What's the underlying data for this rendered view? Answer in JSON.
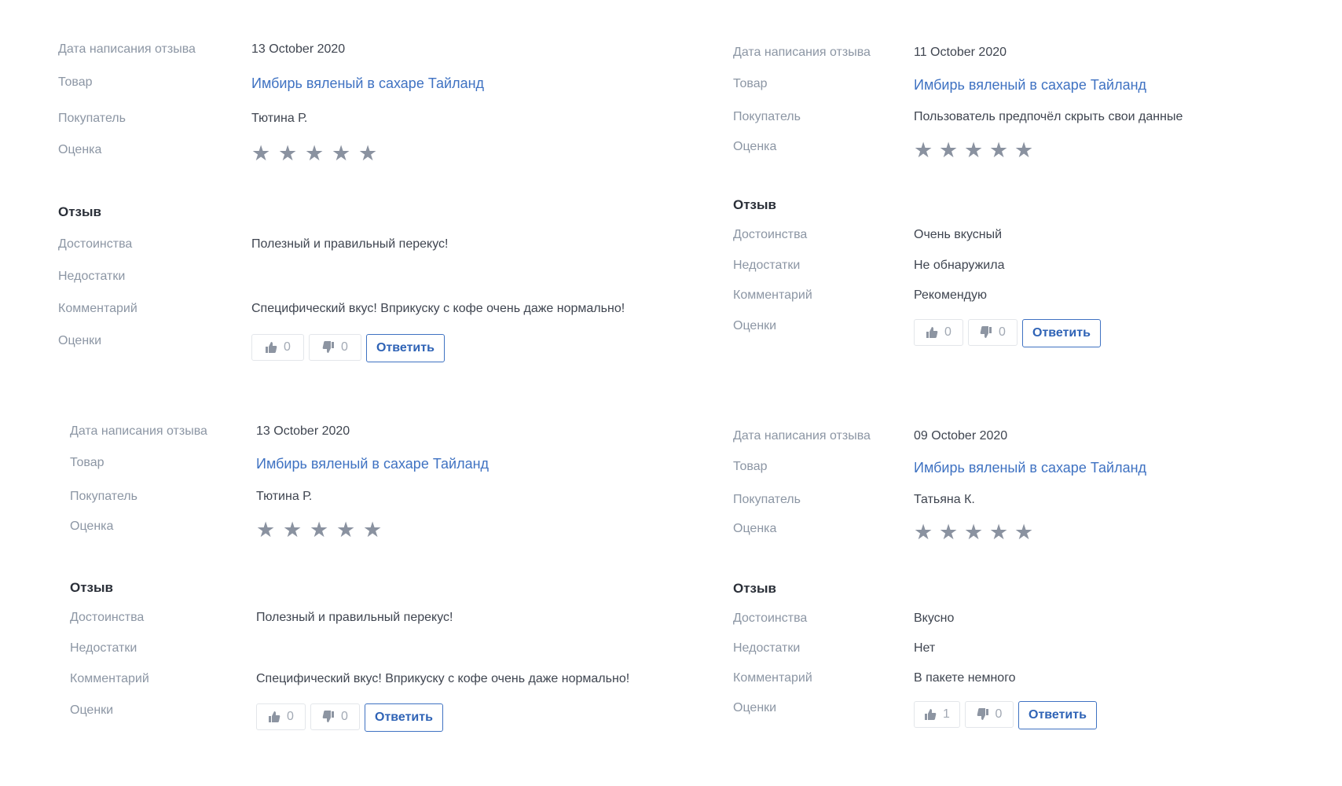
{
  "labels": {
    "date": "Дата написания отзыва",
    "product": "Товар",
    "buyer": "Покупатель",
    "rating": "Оценка",
    "review_section": "Отзыв",
    "pros": "Достоинства",
    "cons": "Недостатки",
    "comment": "Комментарий",
    "votes": "Оценки",
    "reply": "Ответить"
  },
  "reviews": [
    {
      "date": "13 October 2020",
      "product": "Имбирь вяленый в сахаре Тайланд",
      "buyer": "Тютина Р.",
      "stars": 5,
      "pros": "Полезный и правильный перекус!",
      "cons": "",
      "comment": "Специфический вкус! Вприкуску с кофе очень даже нормально!",
      "likes": "0",
      "dislikes": "0"
    },
    {
      "date": "11 October 2020",
      "product": "Имбирь вяленый в сахаре Тайланд",
      "buyer": "Пользователь предпочёл скрыть свои данные",
      "stars": 5,
      "pros": "Очень вкусный",
      "cons": "Не обнаружила",
      "comment": "Рекомендую",
      "likes": "0",
      "dislikes": "0"
    },
    {
      "date": "13 October 2020",
      "product": "Имбирь вяленый в сахаре Тайланд",
      "buyer": "Тютина Р.",
      "stars": 5,
      "pros": "Полезный и правильный перекус!",
      "cons": "",
      "comment": "Специфический вкус! Вприкуску с кофе очень даже нормально!",
      "likes": "0",
      "dislikes": "0"
    },
    {
      "date": "09 October 2020",
      "product": "Имбирь вяленый в сахаре Тайланд",
      "buyer": "Татьяна К.",
      "stars": 5,
      "pros": "Вкусно",
      "cons": "Нет",
      "comment": "В пакете немного",
      "likes": "1",
      "dislikes": "0"
    }
  ],
  "icons": {
    "star": "star-icon",
    "like": "thumbs-up-icon",
    "dislike": "thumbs-down-icon"
  },
  "colors": {
    "link": "#3f72c2",
    "label": "#8c96a4",
    "star": "#8a92a0",
    "button_border": "#3f72c2"
  }
}
